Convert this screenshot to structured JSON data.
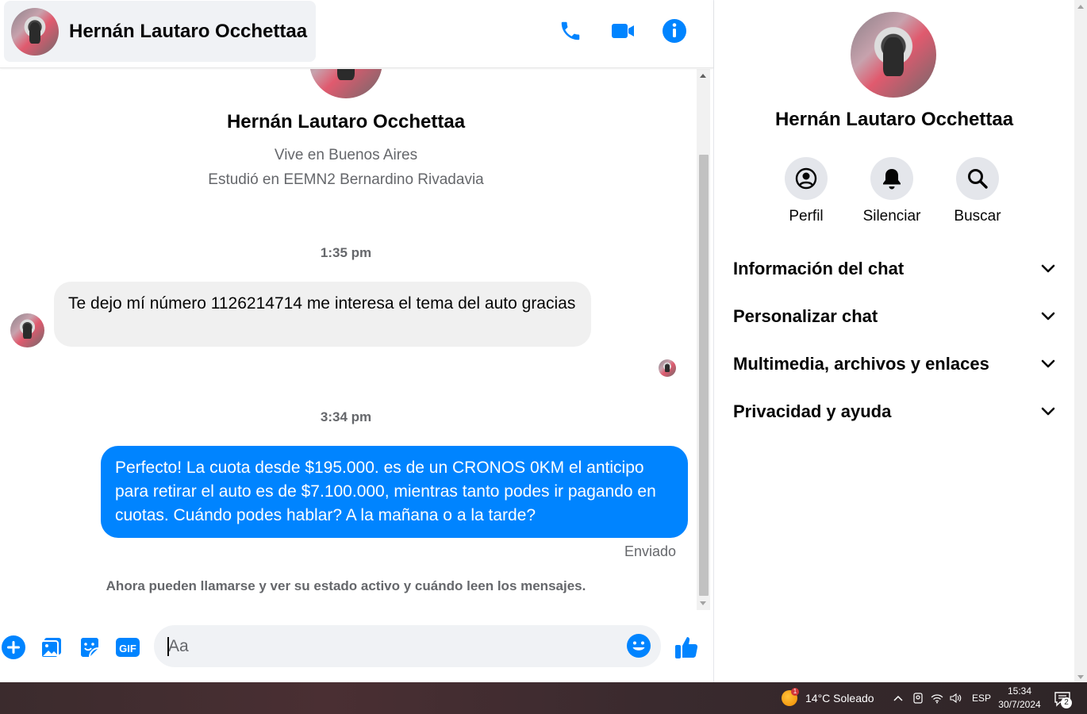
{
  "header": {
    "contact_name": "Hernán Lautaro Occhettaa",
    "icons": [
      "phone-icon",
      "video-camera-icon",
      "info-icon"
    ]
  },
  "conversation": {
    "profile_name": "Hernán Lautaro Occhettaa",
    "lives_in": "Vive en Buenos Aires",
    "studied_at": "Estudió en EEMN2 Bernardino Rivadavia",
    "messages": [
      {
        "timestamp": "1:35 pm",
        "direction": "incoming",
        "text": "Te dejo mí número 1126214714 me interesa el tema del auto gracias"
      },
      {
        "timestamp": "3:34 pm",
        "direction": "outgoing",
        "text": "Perfecto! La cuota desde $195.000. es de un CRONOS 0KM el anticipo para retirar el auto es de $7.100.000, mientras tanto podes ir pagando en cuotas. Cuándo podes hablar? A la mañana o a la tarde?"
      }
    ],
    "sent_status": "Enviado",
    "notice": "Ahora pueden llamarse y ver su estado activo y cuándo leen los mensajes."
  },
  "composer": {
    "placeholder": "Aa",
    "icons": [
      "plus-icon",
      "image-icon",
      "sticker-icon",
      "gif-icon",
      "emoji-icon",
      "like-icon"
    ],
    "gif_label": "GIF"
  },
  "side_panel": {
    "name": "Hernán Lautaro Occhettaa",
    "actions": [
      {
        "label": "Perfil",
        "icon": "profile-icon"
      },
      {
        "label": "Silenciar",
        "icon": "bell-icon"
      },
      {
        "label": "Buscar",
        "icon": "search-icon"
      }
    ],
    "sections": [
      {
        "label": "Información del chat"
      },
      {
        "label": "Personalizar chat"
      },
      {
        "label": "Multimedia, archivos y enlaces"
      },
      {
        "label": "Privacidad y ayuda"
      }
    ]
  },
  "taskbar": {
    "weather": "14°C  Soleado",
    "weather_alert_count": "1",
    "language": "ESP",
    "time": "15:34",
    "date": "30/7/2024",
    "notification_count": "2"
  },
  "colors": {
    "accent": "#0084ff",
    "incoming_bubble": "#f0f0f0",
    "secondary_text": "#65676b",
    "icon_button_bg": "#e4e6eb"
  }
}
